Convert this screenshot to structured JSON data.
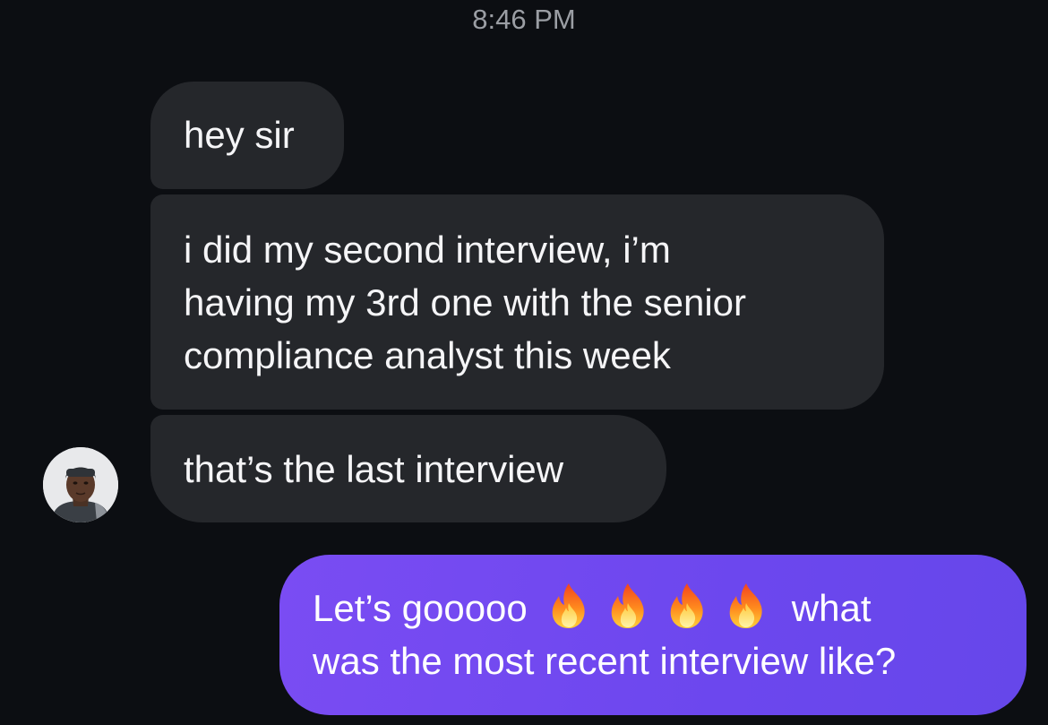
{
  "conversation": {
    "timestamp": "8:46 PM",
    "incoming": [
      {
        "lines": [
          "hey sir"
        ]
      },
      {
        "lines": [
          "i did my second interview, i’m",
          "having my 3rd one with the senior",
          "compliance analyst this week"
        ]
      },
      {
        "lines": [
          "that’s the last interview"
        ]
      }
    ],
    "outgoing": {
      "line1_before": "Let’s gooooo",
      "emoji": [
        "fire-emoji",
        "fire-emoji",
        "fire-emoji",
        "fire-emoji"
      ],
      "line1_after": "what",
      "line2": "was the most recent interview like?"
    },
    "sender_avatar_icon": "contact-avatar",
    "colors": {
      "background": "#0c0e12",
      "incoming_bubble": "#25272b",
      "outgoing_bubble": "#6c47ee",
      "timestamp": "#9b9ea4"
    }
  }
}
